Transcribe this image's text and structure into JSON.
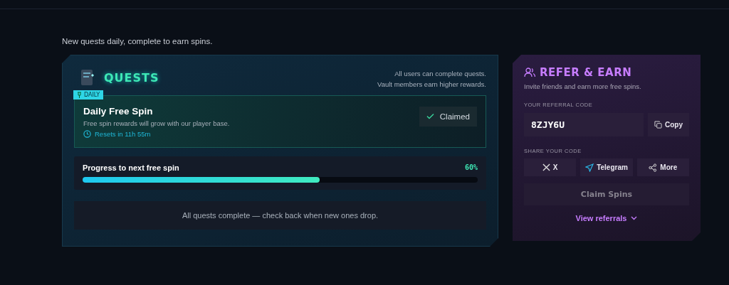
{
  "intro": "New quests daily, complete to earn spins.",
  "quests": {
    "title": "QUESTS",
    "notes": [
      "All users can complete quests.",
      "Vault members earn higher rewards."
    ],
    "items": [
      {
        "tag": "DAILY",
        "title": "Daily Free Spin",
        "description": "Free spin rewards will grow with our player base.",
        "reset": "Resets in 11h 55m",
        "claimed": true,
        "button": "Claimed"
      }
    ],
    "progress": {
      "label": "Progress to next free spin",
      "reading": "60%",
      "level": 0.6
    },
    "empty_message": "All quests complete — check back when new ones drop."
  },
  "refer": {
    "title": "REFER & EARN",
    "subtitle": "Invite friends and earn more free spins.",
    "code_label": "YOUR REFERRAL CODE",
    "code": "8ZJY6U",
    "copy_button": "Copy",
    "share_label": "SHARE YOUR CODE",
    "share_buttons": [
      {
        "kind": "x",
        "label": "X"
      },
      {
        "kind": "telegram",
        "label": "Telegram"
      },
      {
        "kind": "more",
        "label": "More"
      }
    ],
    "claim_button": {
      "label": "Claim Spins",
      "disabled": true
    },
    "view_link": "View referrals"
  }
}
